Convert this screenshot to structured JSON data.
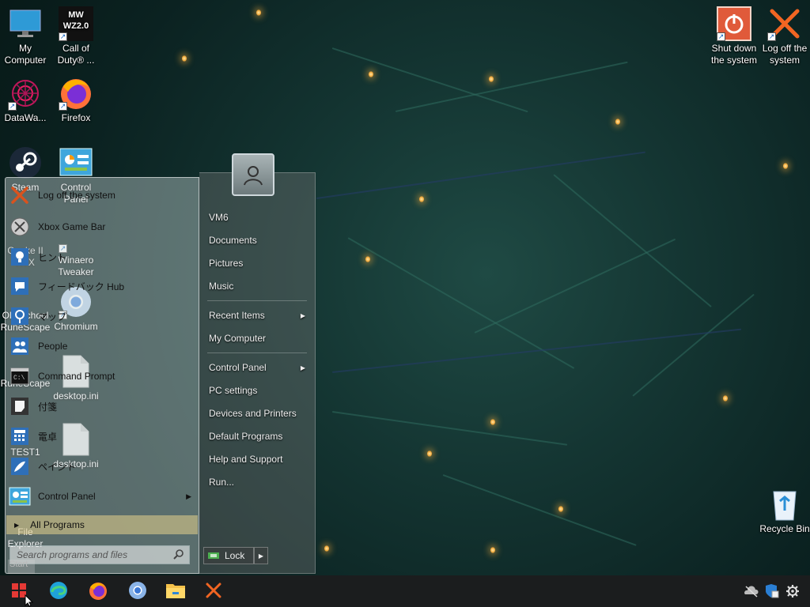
{
  "desktop": {
    "left_icons": [
      {
        "label": "My Computer",
        "icon": "monitor-icon"
      },
      {
        "label": "Call of Duty® ...",
        "icon": "game-mw-wz-icon"
      },
      {
        "label": "DataWa...",
        "icon": "datawave-icon"
      },
      {
        "label": "Firefox",
        "icon": "firefox-icon"
      },
      {
        "label": "Steam",
        "icon": "steam-icon"
      },
      {
        "label": "Control Panel",
        "icon": "control-panel-icon"
      },
      {
        "label": "Quake II RTX",
        "icon": "quake-icon"
      },
      {
        "label": "Winaero Tweaker",
        "icon": "winaero-icon"
      },
      {
        "label": "Old School RuneScape",
        "icon": "runescape-icon"
      },
      {
        "label": "Chromium",
        "icon": "chromium-icon"
      },
      {
        "label": "RuneScape",
        "icon": "runescape-icon"
      },
      {
        "label": "desktop.ini",
        "icon": "file-icon"
      },
      {
        "label": "TEST1",
        "icon": "test-icon"
      },
      {
        "label": "desktop.ini",
        "icon": "file-icon"
      },
      {
        "label": "File Explorer",
        "icon": "folder-icon"
      }
    ],
    "right_icons": [
      {
        "label": "Shut down the system",
        "icon": "power-icon"
      },
      {
        "label": "Log off the system",
        "icon": "logoff-icon"
      },
      {
        "label": "Recycle Bin",
        "icon": "recycle-bin-icon"
      }
    ]
  },
  "start_menu": {
    "left_items": [
      {
        "label": "Log off the system",
        "icon": "logoff-icon"
      },
      {
        "label": "Xbox Game Bar",
        "icon": "xbox-icon"
      },
      {
        "label": "ヒント",
        "icon": "tips-icon"
      },
      {
        "label": "フィードバック Hub",
        "icon": "feedback-icon"
      },
      {
        "label": "マップ",
        "icon": "maps-icon"
      },
      {
        "label": "People",
        "icon": "people-icon"
      },
      {
        "label": "Command Prompt",
        "icon": "cmd-icon"
      },
      {
        "label": "付箋",
        "icon": "sticky-notes-icon"
      },
      {
        "label": "電卓",
        "icon": "calculator-icon"
      },
      {
        "label": "ペイント",
        "icon": "paint-icon"
      },
      {
        "label": "Control Panel",
        "icon": "control-panel-icon",
        "has_submenu": true
      }
    ],
    "all_programs": "All Programs",
    "search_placeholder": "Search programs and files",
    "user_name": "VM6",
    "right_items": [
      {
        "label": "VM6"
      },
      {
        "label": "Documents"
      },
      {
        "label": "Pictures"
      },
      {
        "label": "Music"
      },
      {
        "label": "Recent Items",
        "has_submenu": true
      },
      {
        "label": "My Computer"
      },
      {
        "label": "Control Panel",
        "has_submenu": true
      },
      {
        "label": "PC settings"
      },
      {
        "label": "Devices and Printers"
      },
      {
        "label": "Default Programs"
      },
      {
        "label": "Help and Support"
      },
      {
        "label": "Run..."
      }
    ],
    "lock_label": "Lock",
    "start_ghost": "Start"
  },
  "taskbar": {
    "pinned": [
      {
        "name": "start-button",
        "icon": "windows-logo-icon"
      },
      {
        "name": "edge",
        "icon": "edge-icon"
      },
      {
        "name": "firefox",
        "icon": "firefox-icon"
      },
      {
        "name": "chromium",
        "icon": "chromium-icon"
      },
      {
        "name": "file-explorer",
        "icon": "folder-icon"
      },
      {
        "name": "log-off",
        "icon": "logoff-icon"
      }
    ],
    "tray": [
      {
        "icon": "network-off-icon"
      },
      {
        "icon": "security-icon"
      },
      {
        "icon": "settings-gear-icon"
      }
    ]
  },
  "colors": {
    "taskbar": "#1b1d1e",
    "start_red": "#e53935",
    "wallpaper_dark": "#0b2221"
  }
}
